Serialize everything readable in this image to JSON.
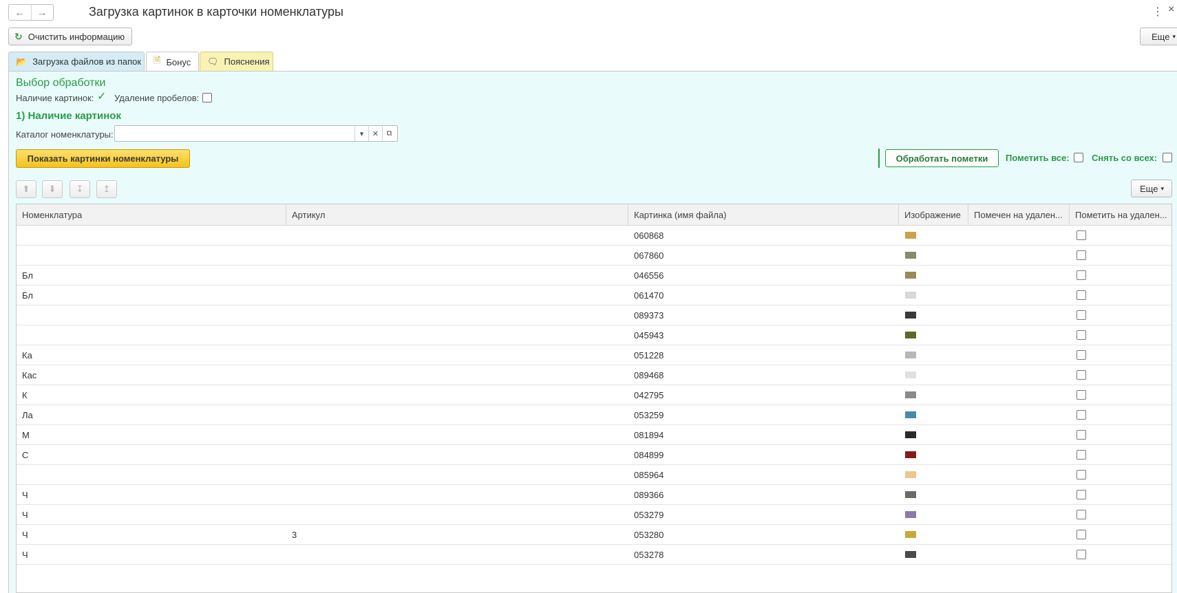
{
  "window": {
    "title": "Загрузка картинок в карточки номенклатуры",
    "kebab": "⋮",
    "close": "×"
  },
  "toolbar": {
    "clear_label": "Очистить информацию",
    "more_label": "Еще"
  },
  "tabs": [
    {
      "label": "Загрузка файлов из папок",
      "icon": "folder-upload-icon"
    },
    {
      "label": "Бонус",
      "icon": "document-icon"
    },
    {
      "label": "Пояснения",
      "icon": "speech-bubble-icon"
    }
  ],
  "selection": {
    "title": "Выбор обработки",
    "has_images_label": "Наличие картинок:",
    "has_images_checked": true,
    "remove_spaces_label": "Удаление пробелов:",
    "remove_spaces_checked": false
  },
  "section1": {
    "title": "1) Наличие картинок",
    "catalog_label": "Каталог номенклатуры:",
    "catalog_value": "",
    "show_button": "Показать картинки номенклатуры",
    "process_button": "Обработать пометки",
    "mark_all_label": "Пометить все:",
    "unmark_all_label": "Снять со всех:",
    "more_label": "Еще"
  },
  "table": {
    "columns": [
      "Номенклатура",
      "Артикул",
      "Картинка (имя файла)",
      "Изображение",
      "Помечен на удален...",
      "Пометить на удален..."
    ],
    "rows": [
      {
        "name": "",
        "article": "",
        "file": "060868",
        "thumb_color": "#c9a24a"
      },
      {
        "name": "",
        "article": "",
        "file": "067860",
        "thumb_color": "#8a8a6a"
      },
      {
        "name": "Бл",
        "article": "",
        "file": "046556",
        "thumb_color": "#9a8a5a"
      },
      {
        "name": "Бл",
        "article": "",
        "file": "061470",
        "thumb_color": "#d8d8d8"
      },
      {
        "name": "",
        "article": "",
        "file": "089373",
        "thumb_color": "#3a3a3a"
      },
      {
        "name": "",
        "article": "",
        "file": "045943",
        "thumb_color": "#5a6a2a"
      },
      {
        "name": "Ка",
        "article": "",
        "file": "051228",
        "thumb_color": "#b8b8b8"
      },
      {
        "name": "Кас",
        "article": "",
        "file": "089468",
        "thumb_color": "#e0e0e0"
      },
      {
        "name": "К",
        "article": "",
        "file": "042795",
        "thumb_color": "#8a8a8a"
      },
      {
        "name": "Ла",
        "article": "",
        "file": "053259",
        "thumb_color": "#4a8aa8"
      },
      {
        "name": "М",
        "article": "",
        "file": "081894",
        "thumb_color": "#2a2a2a"
      },
      {
        "name": "С",
        "article": "",
        "file": "084899",
        "thumb_color": "#8a1a1a"
      },
      {
        "name": "",
        "article": "",
        "file": "085964",
        "thumb_color": "#e8c890"
      },
      {
        "name": "Ч",
        "article": "",
        "file": "089366",
        "thumb_color": "#6a6a6a"
      },
      {
        "name": "Ч",
        "article": "",
        "file": "053279",
        "thumb_color": "#8a7aa8"
      },
      {
        "name": "Ч",
        "article": "3",
        "file": "053280",
        "thumb_color": "#c8a83a"
      },
      {
        "name": "Ч",
        "article": "",
        "file": "053278",
        "thumb_color": "#4a4a4a"
      }
    ]
  }
}
